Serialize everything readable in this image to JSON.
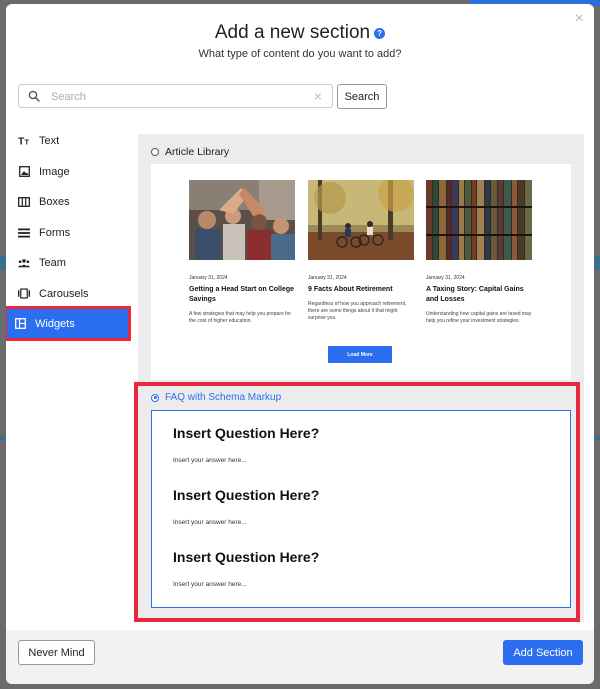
{
  "modal": {
    "title": "Add a new section",
    "subtitle": "What type of content do you want to add?",
    "close_glyph": "×"
  },
  "search": {
    "placeholder": "Search",
    "value": "",
    "button_label": "Search"
  },
  "sidebar": {
    "items": [
      {
        "label": "Text",
        "icon": "text-icon",
        "active": false
      },
      {
        "label": "Image",
        "icon": "image-icon",
        "active": false
      },
      {
        "label": "Boxes",
        "icon": "boxes-icon",
        "active": false
      },
      {
        "label": "Forms",
        "icon": "forms-icon",
        "active": false
      },
      {
        "label": "Team",
        "icon": "team-icon",
        "active": false
      },
      {
        "label": "Carousels",
        "icon": "carousels-icon",
        "active": false
      },
      {
        "label": "Widgets",
        "icon": "widgets-icon",
        "active": true
      }
    ]
  },
  "options": {
    "article_library": {
      "label": "Article Library",
      "selected": false,
      "articles": [
        {
          "image": "students-high-five-photo",
          "date": "January 31, 2024",
          "title": "Getting a Head Start on College Savings",
          "description": "A few strategies that may help you prepare for the cost of higher education."
        },
        {
          "image": "cyclists-autumn-photo",
          "date": "January 31, 2024",
          "title": "9 Facts About Retirement",
          "description": "Regardless of how you approach retirement, there are some things about it that might surprise you."
        },
        {
          "image": "bookshelf-photo",
          "date": "January 31, 2024",
          "title": "A Taxing Story: Capital Gains and Losses",
          "description": "Understanding how capital gains are taxed may help you refine your investment strategies."
        }
      ],
      "load_more_label": "Load More"
    },
    "faq": {
      "label": "FAQ with Schema Markup",
      "selected": true,
      "items": [
        {
          "question": "Insert Question Here?",
          "answer": "Insert your answer here..."
        },
        {
          "question": "Insert Question Here?",
          "answer": "Insert your answer here..."
        },
        {
          "question": "Insert Question Here?",
          "answer": "Insert your answer here..."
        }
      ]
    }
  },
  "footer": {
    "cancel_label": "Never Mind",
    "submit_label": "Add Section"
  },
  "colors": {
    "accent": "#2b6ff0",
    "highlight": "#e8283c",
    "overlay": "#6b6b6b",
    "panel": "#ececec"
  }
}
